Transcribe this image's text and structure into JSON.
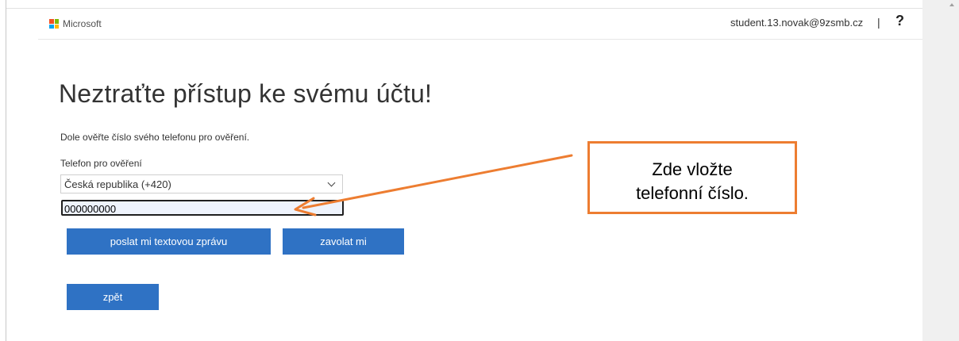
{
  "header": {
    "brand": "Microsoft",
    "user_email": "student.13.novak@9zsmb.cz",
    "separator": "|",
    "help": "?"
  },
  "logo_colors": [
    "#f25022",
    "#7fba00",
    "#00a4ef",
    "#ffb900"
  ],
  "main": {
    "title": "Neztraťte přístup ke svému účtu!",
    "description": "Dole ověřte číslo svého telefonu pro ověření.",
    "phone_label": "Telefon pro ověření",
    "country_select": "Česká republika (+420)",
    "phone_value": "000000000",
    "send_sms_label": "poslat mi textovou zprávu",
    "call_label": "zavolat mi",
    "back_label": "zpět"
  },
  "callout": {
    "line1": "Zde vložte",
    "line2": "telefonní číslo."
  },
  "colors": {
    "button": "#2f72c4",
    "callout_border": "#ed7d31",
    "arrow": "#ed7d31"
  }
}
